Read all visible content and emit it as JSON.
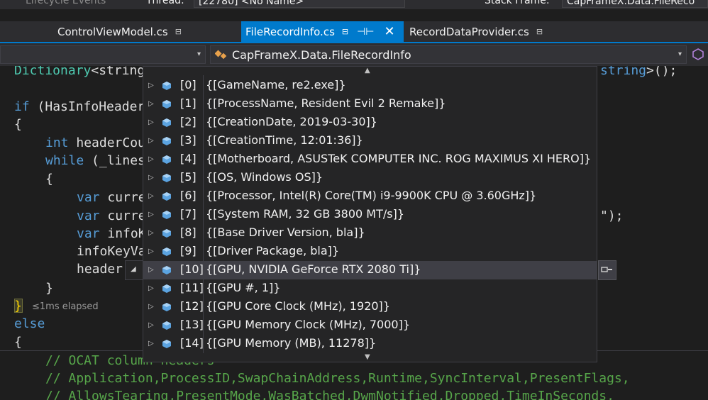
{
  "debug_bar": {
    "lifecycle_label": "Lifecycle Events",
    "thread_label": "Thread:",
    "thread_value": "[22780] <No Name>",
    "stack_frame_label": "Stack Frame:",
    "stack_frame_value": "CapFrameX.Data.FileReco"
  },
  "tabs": [
    {
      "label": "ControlViewModel.cs",
      "pin": "⊟"
    },
    {
      "label": "FileRecordInfo.cs",
      "pin": "⊟",
      "ctrl": "⊣⊢",
      "close": "✕"
    },
    {
      "label": "RecordDataProvider.cs",
      "pin": "⊟"
    }
  ],
  "nav": {
    "left_arrow": "▾",
    "class_label": "CapFrameX.Data.FileRecordInfo",
    "class_icon": "class-icon",
    "class_arrow": "▾"
  },
  "code": {
    "line1_type": "Dictionary",
    "line1_text": "<string",
    "line1_tail": "string>();",
    "line2_kw": "if",
    "line2_text": " (HasInfoHeader",
    "line3_text": "{",
    "line4_kw": "int",
    "line4_text": " headerCou",
    "line5_kw": "while",
    "line5_text": " (_lines",
    "line6_text": "{",
    "line7_kw": "var",
    "line7_text": " curre",
    "line8_kw": "var",
    "line8_text": " curre",
    "line8_tail": "\");",
    "line9_kw": "var",
    "line9_text": " infoK",
    "line10_text": "infoKeyVa",
    "line11_text": "header",
    "line12_text": "}",
    "line13_text": "}",
    "elapsed": "≤1ms elapsed",
    "line14_kw": "else",
    "line15_text": "{",
    "line16_text": "// OCAT column headers",
    "line17_text": "// Application,ProcessID,SwapChainAddress,Runtime,SyncInterval,PresentFlags,",
    "line18_text": "// AllowsTearing,PresentMode,WasBatched,DwmNotified,Dropped,TimeInSeconds,"
  },
  "datatip": {
    "small_arrow": "◢",
    "scroll_up": "▲",
    "scroll_down": "▼",
    "expand_icon": "magnifier-icon",
    "rows": [
      {
        "name": "[0]",
        "value": "{[GameName, re2.exe]}"
      },
      {
        "name": "[1]",
        "value": "{[ProcessName, Resident Evil 2 Remake]}"
      },
      {
        "name": "[2]",
        "value": "{[CreationDate, 2019-03-30]}"
      },
      {
        "name": "[3]",
        "value": "{[CreationTime, 12:01:36]}"
      },
      {
        "name": "[4]",
        "value": "{[Motherboard, ASUSTeK COMPUTER INC. ROG MAXIMUS XI HERO]}"
      },
      {
        "name": "[5]",
        "value": "{[OS, Windows OS]}"
      },
      {
        "name": "[6]",
        "value": "{[Processor, Intel(R) Core(TM) i9-9900K CPU @ 3.60GHz]}"
      },
      {
        "name": "[7]",
        "value": "{[System RAM, 32 GB 3800 MT/s]}"
      },
      {
        "name": "[8]",
        "value": "{[Base Driver Version, bla]}"
      },
      {
        "name": "[9]",
        "value": "{[Driver Package, bla]}"
      },
      {
        "name": "[10]",
        "value": "{[GPU, NVIDIA GeForce RTX 2080 Ti]}"
      },
      {
        "name": "[11]",
        "value": "{[GPU #, 1]}"
      },
      {
        "name": "[12]",
        "value": "{[GPU Core Clock (MHz), 1920]}"
      },
      {
        "name": "[13]",
        "value": "{[GPU Memory Clock (MHz), 7000]}"
      },
      {
        "name": "[14]",
        "value": "{[GPU Memory (MB), 11278]}"
      }
    ],
    "highlighted_index": 10
  },
  "colors": {
    "accent": "#007acc",
    "keyword": "#569cd6",
    "type": "#4ec9b0",
    "comment": "#57a64a",
    "cube": "#5ba3e0"
  }
}
